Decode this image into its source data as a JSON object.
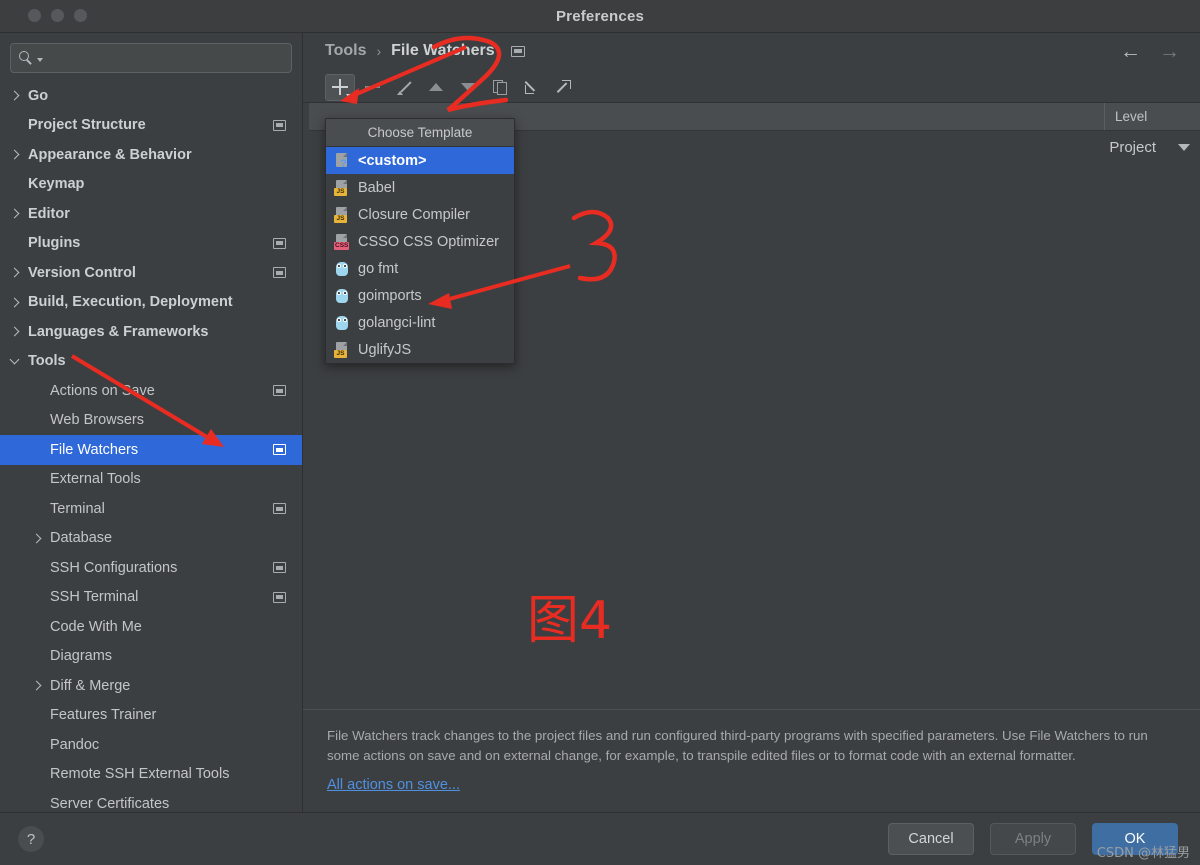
{
  "window": {
    "title": "Preferences",
    "traffic_lights": [
      "close",
      "minimize",
      "zoom"
    ]
  },
  "search": {
    "value": "",
    "placeholder": "",
    "icon": "search-icon"
  },
  "sidebar": {
    "items": [
      {
        "label": "Go",
        "arrow": "right",
        "bold": true,
        "cfg": false,
        "indent": 0,
        "selected": false
      },
      {
        "label": "Project Structure",
        "arrow": "none",
        "bold": true,
        "cfg": true,
        "indent": 0,
        "selected": false
      },
      {
        "label": "Appearance & Behavior",
        "arrow": "right",
        "bold": true,
        "cfg": false,
        "indent": 0,
        "selected": false
      },
      {
        "label": "Keymap",
        "arrow": "none",
        "bold": true,
        "cfg": false,
        "indent": 0,
        "selected": false
      },
      {
        "label": "Editor",
        "arrow": "right",
        "bold": true,
        "cfg": false,
        "indent": 0,
        "selected": false
      },
      {
        "label": "Plugins",
        "arrow": "none",
        "bold": true,
        "cfg": true,
        "indent": 0,
        "selected": false
      },
      {
        "label": "Version Control",
        "arrow": "right",
        "bold": true,
        "cfg": true,
        "indent": 0,
        "selected": false
      },
      {
        "label": "Build, Execution, Deployment",
        "arrow": "right",
        "bold": true,
        "cfg": false,
        "indent": 0,
        "selected": false
      },
      {
        "label": "Languages & Frameworks",
        "arrow": "right",
        "bold": true,
        "cfg": false,
        "indent": 0,
        "selected": false
      },
      {
        "label": "Tools",
        "arrow": "down",
        "bold": true,
        "cfg": false,
        "indent": 0,
        "selected": false
      },
      {
        "label": "Actions on Save",
        "arrow": "none",
        "bold": false,
        "cfg": true,
        "indent": 1,
        "selected": false
      },
      {
        "label": "Web Browsers",
        "arrow": "none",
        "bold": false,
        "cfg": false,
        "indent": 1,
        "selected": false
      },
      {
        "label": "File Watchers",
        "arrow": "none",
        "bold": false,
        "cfg": true,
        "indent": 1,
        "selected": true
      },
      {
        "label": "External Tools",
        "arrow": "none",
        "bold": false,
        "cfg": false,
        "indent": 1,
        "selected": false
      },
      {
        "label": "Terminal",
        "arrow": "none",
        "bold": false,
        "cfg": true,
        "indent": 1,
        "selected": false
      },
      {
        "label": "Database",
        "arrow": "right",
        "bold": false,
        "cfg": false,
        "indent": 1,
        "selected": false
      },
      {
        "label": "SSH Configurations",
        "arrow": "none",
        "bold": false,
        "cfg": true,
        "indent": 1,
        "selected": false
      },
      {
        "label": "SSH Terminal",
        "arrow": "none",
        "bold": false,
        "cfg": true,
        "indent": 1,
        "selected": false
      },
      {
        "label": "Code With Me",
        "arrow": "none",
        "bold": false,
        "cfg": false,
        "indent": 1,
        "selected": false
      },
      {
        "label": "Diagrams",
        "arrow": "none",
        "bold": false,
        "cfg": false,
        "indent": 1,
        "selected": false
      },
      {
        "label": "Diff & Merge",
        "arrow": "right",
        "bold": false,
        "cfg": false,
        "indent": 1,
        "selected": false
      },
      {
        "label": "Features Trainer",
        "arrow": "none",
        "bold": false,
        "cfg": false,
        "indent": 1,
        "selected": false
      },
      {
        "label": "Pandoc",
        "arrow": "none",
        "bold": false,
        "cfg": false,
        "indent": 1,
        "selected": false
      },
      {
        "label": "Remote SSH External Tools",
        "arrow": "none",
        "bold": false,
        "cfg": false,
        "indent": 1,
        "selected": false
      },
      {
        "label": "Server Certificates",
        "arrow": "none",
        "bold": false,
        "cfg": false,
        "indent": 1,
        "selected": false
      }
    ]
  },
  "breadcrumb": {
    "parent": "Tools",
    "separator": "›",
    "current": "File Watchers",
    "cfg_icon": "settings-icon"
  },
  "navigation": {
    "back": "←",
    "forward": "→"
  },
  "toolbar": {
    "buttons": [
      {
        "name": "add-watcher-button",
        "icon": "plus-icon",
        "state": "active"
      },
      {
        "name": "remove-watcher-button",
        "icon": "minus-icon",
        "state": "disabled"
      },
      {
        "name": "edit-watcher-button",
        "icon": "pencil-icon",
        "state": "disabled"
      },
      {
        "name": "move-up-button",
        "icon": "triangle-up-icon",
        "state": "disabled"
      },
      {
        "name": "move-down-button",
        "icon": "triangle-down-icon",
        "state": "disabled"
      },
      {
        "name": "copy-watcher-button",
        "icon": "copy-icon",
        "state": "disabled"
      },
      {
        "name": "import-button",
        "icon": "arrow-import-icon",
        "state": "enabled"
      },
      {
        "name": "export-button",
        "icon": "arrow-export-icon",
        "state": "enabled"
      }
    ]
  },
  "table": {
    "headers": {
      "main": "",
      "level": "Level"
    },
    "rows": [
      {
        "name": "",
        "level": "Project"
      }
    ]
  },
  "popup": {
    "title": "Choose Template",
    "items": [
      {
        "label": "<custom>",
        "icon": "custom-file-icon",
        "selected": true
      },
      {
        "label": "Babel",
        "icon": "js-file-icon",
        "selected": false
      },
      {
        "label": "Closure Compiler",
        "icon": "js-file-icon",
        "selected": false
      },
      {
        "label": "CSSO CSS Optimizer",
        "icon": "css-file-icon",
        "selected": false
      },
      {
        "label": "go fmt",
        "icon": "go-gopher-icon",
        "selected": false
      },
      {
        "label": "goimports",
        "icon": "go-gopher-icon",
        "selected": false
      },
      {
        "label": "golangci-lint",
        "icon": "go-gopher-icon",
        "selected": false
      },
      {
        "label": "UglifyJS",
        "icon": "js-file-icon",
        "selected": false
      }
    ]
  },
  "description": {
    "text": "File Watchers track changes to the project files and run configured third-party programs with specified parameters. Use File Watchers to run some actions on save and on external change, for example, to transpile edited files or to format code with an external formatter.",
    "link": "All actions on save..."
  },
  "footer": {
    "help": "?",
    "cancel": "Cancel",
    "apply": "Apply",
    "ok": "OK"
  },
  "annotations": {
    "number_2": "2",
    "number_3": "3",
    "figure_label": "图4",
    "color": "#e82c22"
  },
  "watermark": "CSDN @林猛男"
}
